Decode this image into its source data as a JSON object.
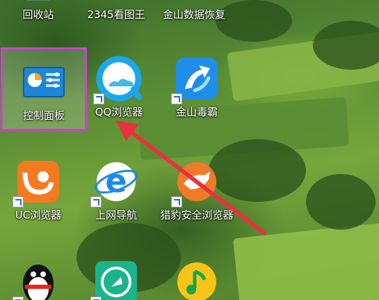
{
  "desktop": {
    "icons": [
      {
        "label": "回收站",
        "icon": "recycle-bin-icon"
      },
      {
        "label": "2345看图王",
        "icon": "image-viewer-icon"
      },
      {
        "label": "金山数据恢复",
        "icon": "data-recovery-icon"
      },
      {
        "label": "控制面板",
        "icon": "control-panel-icon",
        "selected": true
      },
      {
        "label": "QQ浏览器",
        "icon": "qq-browser-icon"
      },
      {
        "label": "金山毒霸",
        "icon": "kingsoft-antivirus-icon"
      },
      {
        "label": "UC浏览器",
        "icon": "uc-browser-icon"
      },
      {
        "label": "上网导航",
        "icon": "web-navigation-icon"
      },
      {
        "label": "猎豹安全浏览器",
        "icon": "cheetah-browser-icon"
      },
      {
        "label": "",
        "icon": "qq-penguin-icon"
      },
      {
        "label": "",
        "icon": "rocket-app-icon"
      },
      {
        "label": "",
        "icon": "qq-music-icon"
      }
    ]
  },
  "annotation": {
    "color": "#e8323c",
    "highlight_color": "#d93adf"
  }
}
